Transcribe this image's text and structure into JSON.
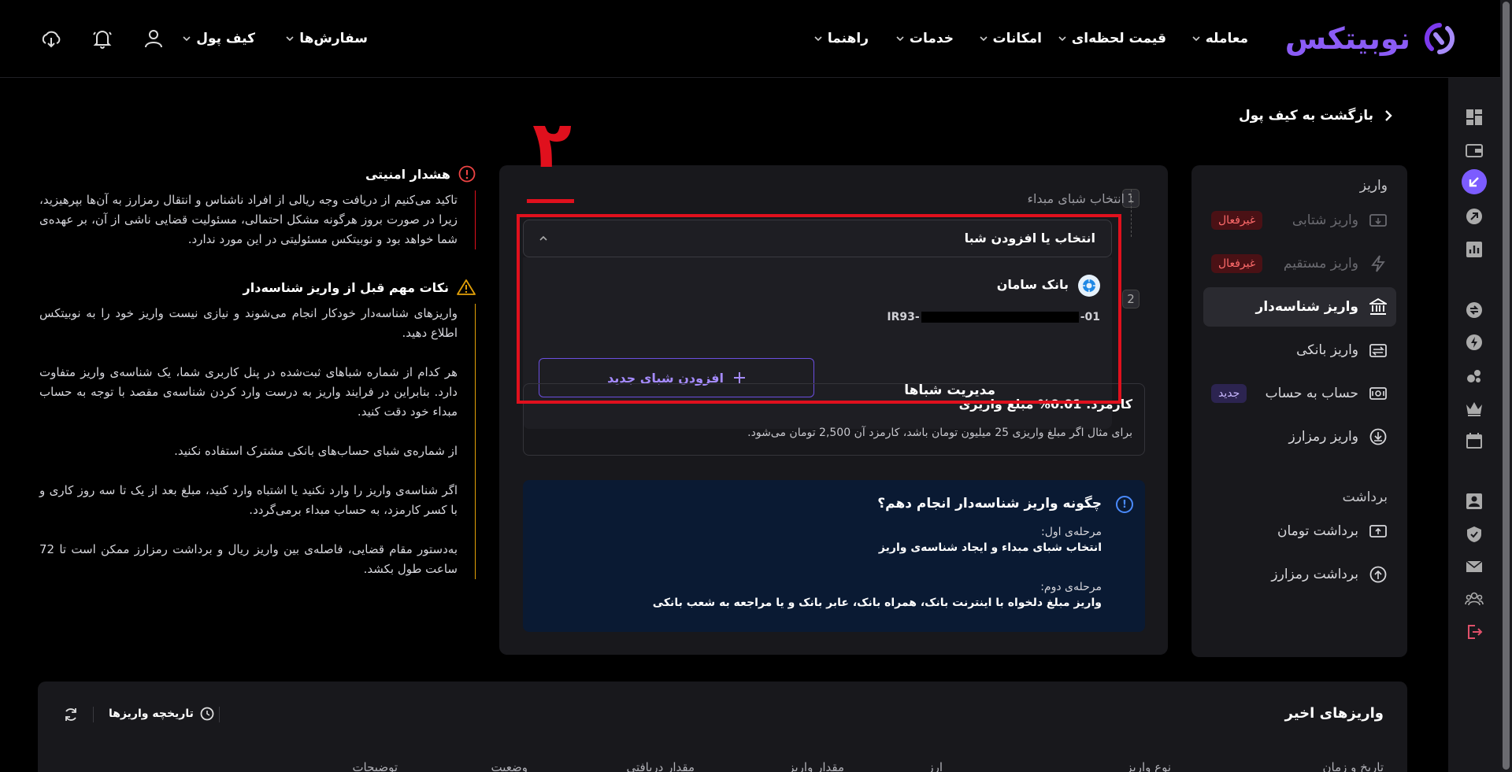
{
  "header": {
    "logo_text": "نوبیتکس",
    "nav": [
      {
        "label": "معامله"
      },
      {
        "label": "قیمت لحظه‌ای"
      },
      {
        "label": "امکانات"
      },
      {
        "label": "خدمات"
      },
      {
        "label": "راهنما"
      },
      {
        "label": "سفارش‌ها"
      },
      {
        "label": "کیف پول"
      }
    ]
  },
  "back_label": "بازگشت به کیف پول",
  "menu": {
    "deposit_heading": "واریز",
    "withdraw_heading": "برداشت",
    "items": [
      {
        "label": "واریز شتابی",
        "badge": "غیرفعال"
      },
      {
        "label": "واریز مستقیم",
        "badge": "غیرفعال"
      },
      {
        "label": "واریز شناسه‌دار"
      },
      {
        "label": "واریز بانکی"
      },
      {
        "label": "حساب به حساب",
        "badge": "جدید"
      },
      {
        "label": "واریز رمزارز"
      },
      {
        "label": "برداشت تومان"
      },
      {
        "label": "برداشت رمزارز"
      }
    ]
  },
  "steps": [
    {
      "num": "1",
      "title": "انتخاب شبای مبداء"
    },
    {
      "num": "2"
    }
  ],
  "select": {
    "label": "انتخاب یا افزودن شبا"
  },
  "bank": {
    "name": "بانک سامان",
    "iban_prefix": "IR93-",
    "iban_suffix": "-01"
  },
  "manage_label": "مدیریت شباها",
  "add_label": "افزودن شبای جدید",
  "annotation": "۲",
  "fee": {
    "title": "کارمزد: 0.01% مبلغ واریزی",
    "desc": "برای مثال اگر مبلغ واریزی 25 میلیون تومان باشد، کارمزد آن 2,500 تومان می‌شود."
  },
  "how": {
    "title": "چگونه واریز شناسه‌دار انجام دهم؟",
    "step1_label": "مرحله‌ی اول:",
    "step1_text": "انتخاب شبای مبداء و ایجاد شناسه‌ی واریز",
    "step2_label": "مرحله‌ی دوم:",
    "step2_text": "واریز مبلغ دلخواه با اینترنت بانک، همراه بانک، عابر بانک و یا مراجعه به شعب بانکی"
  },
  "security": {
    "title": "هشدار امنیتی",
    "body": "تاکید می‌کنیم از دریافت وجه ریالی از افراد ناشناس و انتقال رمزارز به آن‌ها بپرهیزید، زیرا در صورت بروز هرگونه مشکل احتمالی، مسئولیت قضایی ناشی از آن، بر عهده‌ی شما خواهد بود و نوبیتکس مسئولیتی در این مورد ندارد."
  },
  "tips": {
    "title": "نکات مهم قبل از واریز شناسه‌دار",
    "paragraphs": [
      "واریزهای شناسه‌دار خودکار انجام می‌شوند و نیازی نیست واریز خود را به نوبیتکس اطلاع دهید.",
      "هر کدام از شماره شباهای ثبت‌شده در پنل کاربری شما، یک شناسه‌ی واریز متفاوت دارد. بنابراین در فرایند واریز به درست وارد کردن شناسه‌ی مقصد با توجه به حساب مبداء خود دقت کنید.",
      "از شماره‌ی شبای حساب‌های بانکی مشترک استفاده نکنید.",
      "اگر شناسه‌ی واریز را وارد نکنید یا اشتباه وارد کنید، مبلغ بعد از یک تا سه روز کاری و با کسر کارمزد، به حساب مبداء برمی‌گردد.",
      "به‌دستور مقام قضایی، فاصله‌ی بین واریز ریال و برداشت رمزارز ممکن است تا 72 ساعت طول بکشد."
    ]
  },
  "recent": {
    "title": "واریزهای اخیر",
    "history_label": "تاریخچه واریزها",
    "columns": [
      "تاریخ و زمان",
      "نوع واریز",
      "ارز",
      "مقدار واریز",
      "مقدار دریافتی",
      "وضعیت",
      "توضیحات"
    ]
  }
}
